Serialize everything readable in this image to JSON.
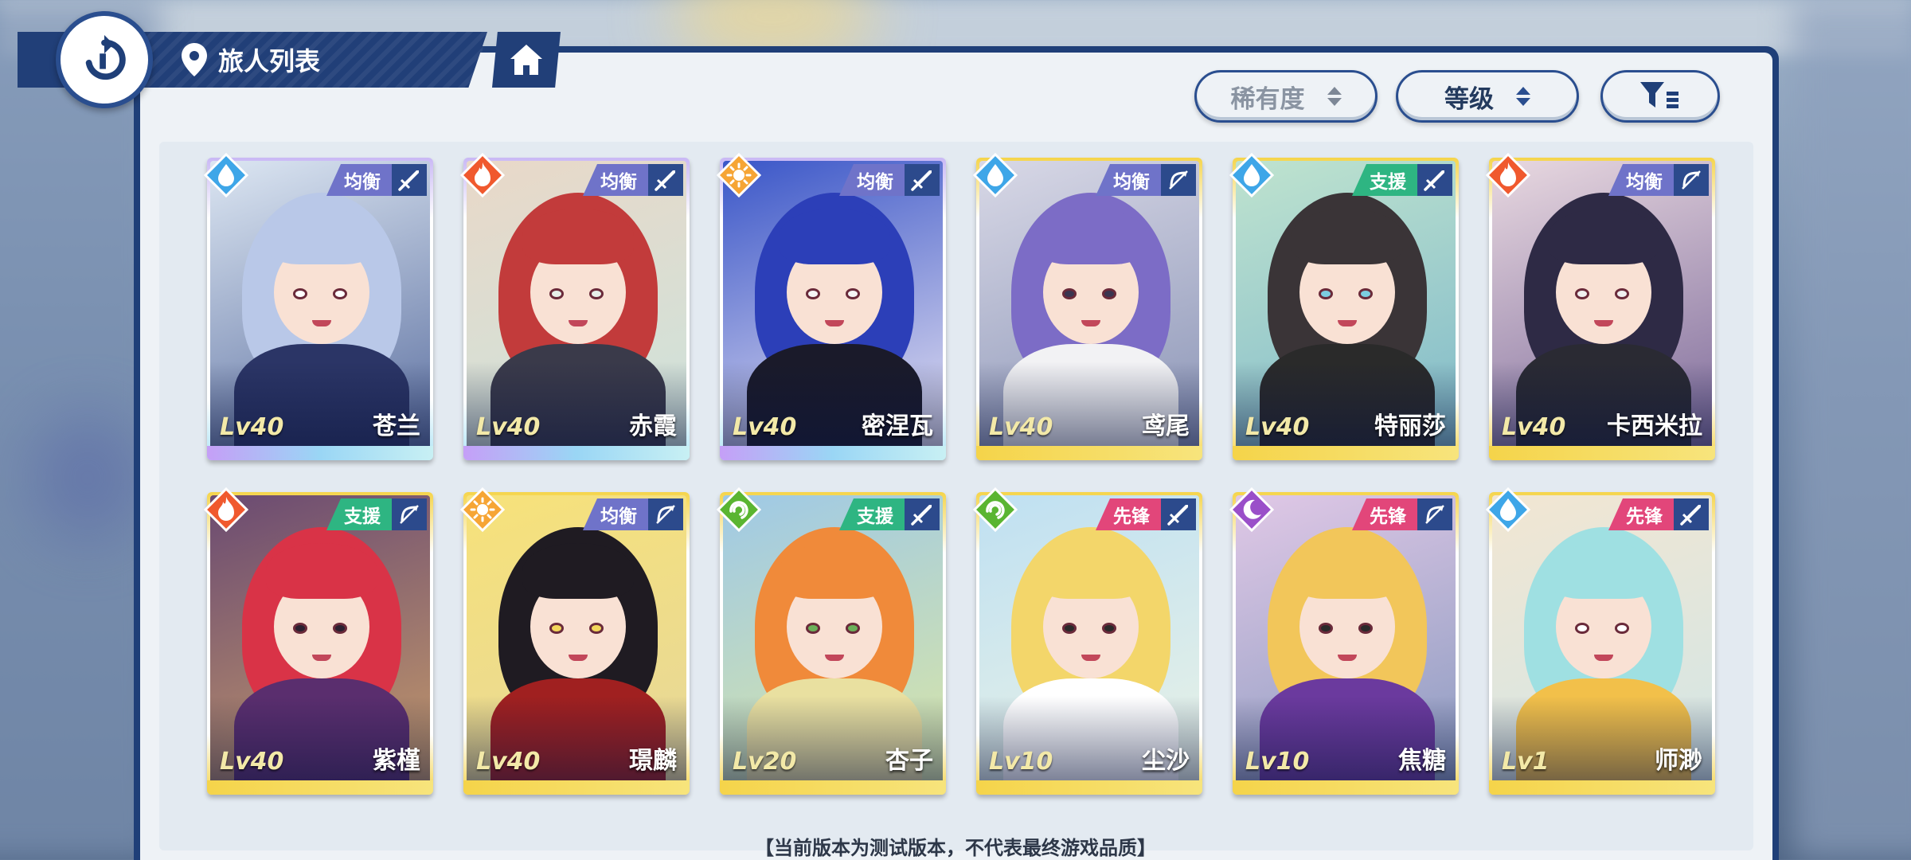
{
  "header": {
    "title": "旅人列表",
    "back_icon": "back-arrow-icon",
    "location_icon": "location-pin-icon",
    "home_icon": "home-icon"
  },
  "controls": {
    "rarity_label": "稀有度",
    "level_label": "等级",
    "filter_icon": "filter-icon"
  },
  "colors": {
    "panel_border": "#1f3f78",
    "water": "#3ea6e8",
    "fire": "#f0592e",
    "light": "#f6a535",
    "wind": "#5ab531",
    "dark": "#9a4fc9",
    "role_balance": "#6f73c9",
    "role_support": "#2eb582",
    "role_vanguard": "#e2467a",
    "rarity_top": "#c59ff7",
    "rarity_gold": "#f5d44a"
  },
  "characters": [
    {
      "name": "苍兰",
      "level": "Lv40",
      "element": "water",
      "role": "均衡",
      "weapon": "sword",
      "rarity": "top"
    },
    {
      "name": "赤霞",
      "level": "Lv40",
      "element": "fire",
      "role": "均衡",
      "weapon": "sword",
      "rarity": "top"
    },
    {
      "name": "密涅瓦",
      "level": "Lv40",
      "element": "light",
      "role": "均衡",
      "weapon": "sword",
      "rarity": "top"
    },
    {
      "name": "鸢尾",
      "level": "Lv40",
      "element": "water",
      "role": "均衡",
      "weapon": "bow",
      "rarity": "gold"
    },
    {
      "name": "特丽莎",
      "level": "Lv40",
      "element": "water",
      "role": "支援",
      "weapon": "sword",
      "rarity": "gold"
    },
    {
      "name": "卡西米拉",
      "level": "Lv40",
      "element": "fire",
      "role": "均衡",
      "weapon": "bow",
      "rarity": "gold"
    },
    {
      "name": "紫槿",
      "level": "Lv40",
      "element": "fire",
      "role": "支援",
      "weapon": "bow",
      "rarity": "gold"
    },
    {
      "name": "璟麟",
      "level": "Lv40",
      "element": "light",
      "role": "均衡",
      "weapon": "bow",
      "rarity": "gold"
    },
    {
      "name": "杏子",
      "level": "Lv20",
      "element": "wind",
      "role": "支援",
      "weapon": "sword",
      "rarity": "gold"
    },
    {
      "name": "尘沙",
      "level": "Lv10",
      "element": "wind",
      "role": "先锋",
      "weapon": "sword",
      "rarity": "gold"
    },
    {
      "name": "焦糖",
      "level": "Lv10",
      "element": "dark",
      "role": "先锋",
      "weapon": "bow",
      "rarity": "gold"
    },
    {
      "name": "师渺",
      "level": "Lv1",
      "element": "water",
      "role": "先锋",
      "weapon": "sword",
      "rarity": "gold"
    }
  ],
  "footer": {
    "note": "【当前版本为测试版本，不代表最终游戏品质】"
  }
}
